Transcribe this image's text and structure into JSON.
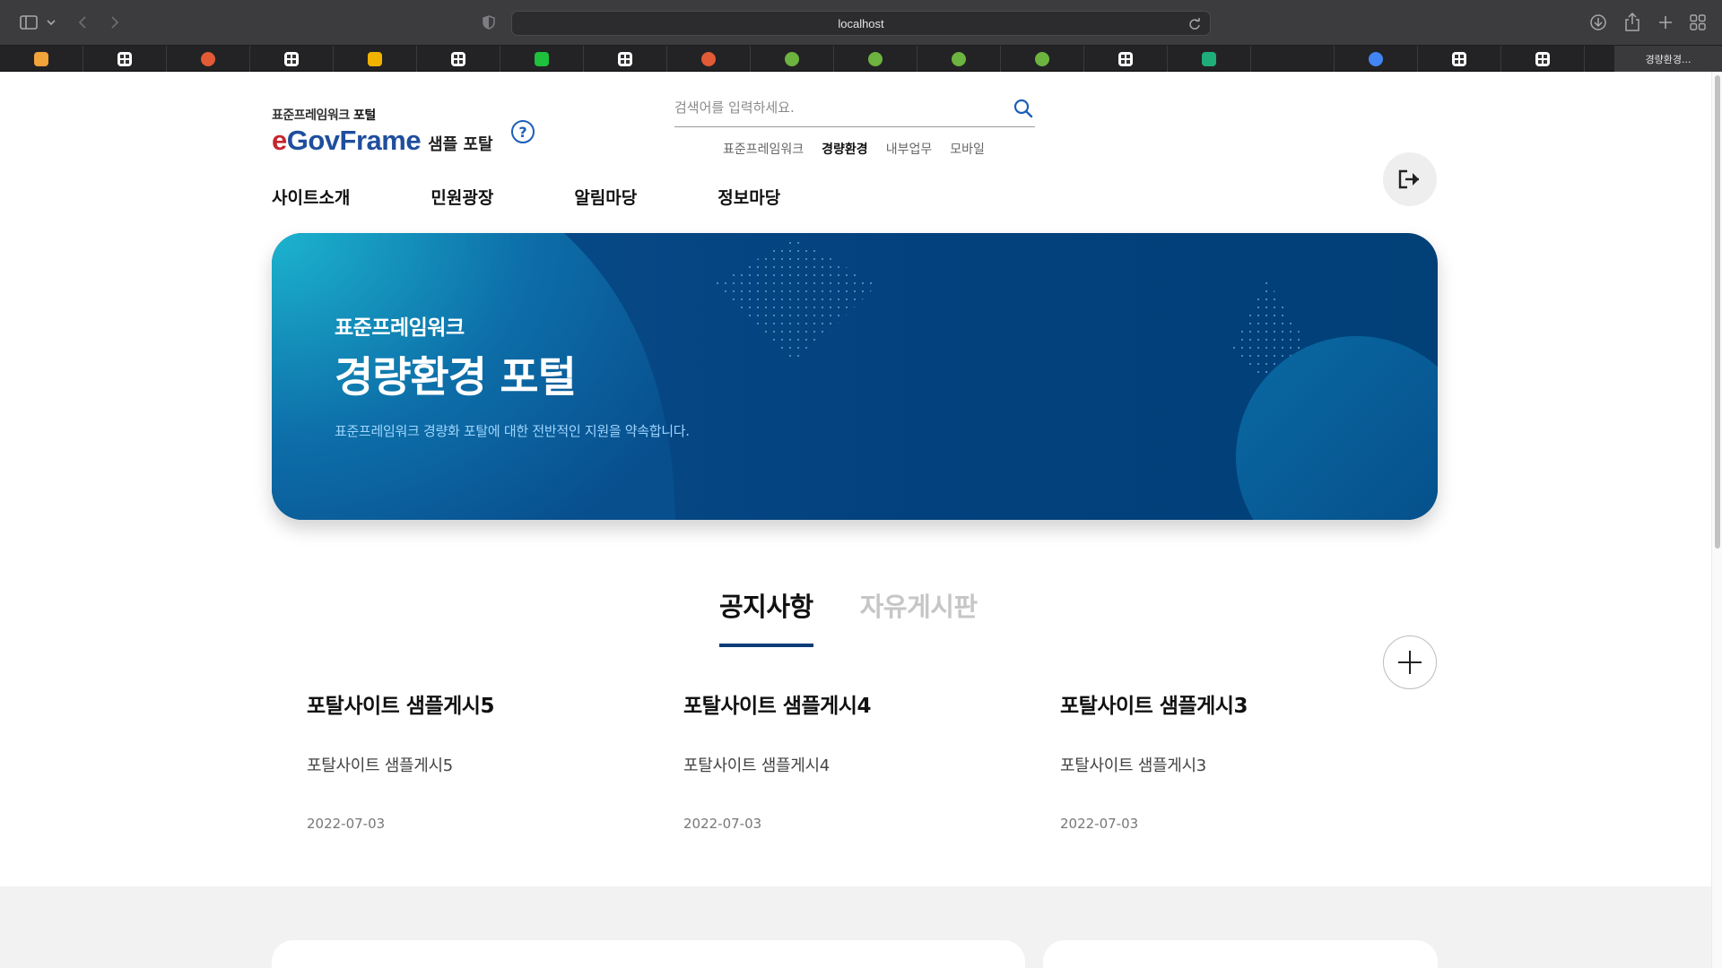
{
  "browser": {
    "url": "localhost",
    "active_tab_title": "경량환경...",
    "bookmarks": [
      {
        "icon": "orange-square-icon",
        "color": "#f2a33a"
      },
      {
        "icon": "grid-app-icon",
        "color": "#ffffff"
      },
      {
        "icon": "striped-flag-icon",
        "color": "#e25b36"
      },
      {
        "icon": "grid-app-icon",
        "color": "#ffffff"
      },
      {
        "icon": "d-logo-icon",
        "color": "#f0b400"
      },
      {
        "icon": "grid-app-icon",
        "color": "#ffffff"
      },
      {
        "icon": "green-chat-icon",
        "color": "#1ec03c"
      },
      {
        "icon": "grid-app-icon",
        "color": "#ffffff"
      },
      {
        "icon": "striped-flag-icon",
        "color": "#e25b36"
      },
      {
        "icon": "spring-leaf-icon",
        "color": "#6db33f"
      },
      {
        "icon": "spring-leaf-icon",
        "color": "#6db33f"
      },
      {
        "icon": "spring-leaf-icon",
        "color": "#6db33f"
      },
      {
        "icon": "spring-leaf-icon",
        "color": "#6db33f"
      },
      {
        "icon": "grid-app-icon",
        "color": "#ffffff"
      },
      {
        "icon": "v-logo-icon",
        "color": "#1fae7a"
      },
      {
        "icon": "empty",
        "color": ""
      },
      {
        "icon": "google-g-icon",
        "color": "#4285f4"
      },
      {
        "icon": "grid-app-icon",
        "color": "#ffffff"
      },
      {
        "icon": "grid-app-icon",
        "color": "#ffffff"
      }
    ]
  },
  "header": {
    "logo_sub_prefix": "표준프레임워크",
    "logo_sub_bold": "포털",
    "logo_e": "e",
    "logo_name": "GovFrame",
    "logo_tail": "샘플 포탈",
    "help_label": "?",
    "search_placeholder": "검색어를 입력하세요.",
    "subnav": [
      {
        "label": "표준프레임워크",
        "active": false
      },
      {
        "label": "경량환경",
        "active": true
      },
      {
        "label": "내부업무",
        "active": false
      },
      {
        "label": "모바일",
        "active": false
      }
    ],
    "gnb": [
      "사이트소개",
      "민원광장",
      "알림마당",
      "정보마당"
    ]
  },
  "hero": {
    "title_small": "표준프레임워크",
    "title_large": "경량환경 포털",
    "description": "표준프레임워크 경량화 포탈에 대한 전반적인 지원을 약속합니다."
  },
  "board": {
    "tabs": [
      {
        "label": "공지사항",
        "active": true
      },
      {
        "label": "자유게시판",
        "active": false
      }
    ],
    "posts": [
      {
        "title": "포탈사이트 샘플게시5",
        "body": "포탈사이트 샘플게시5",
        "date": "2022-07-03"
      },
      {
        "title": "포탈사이트 샘플게시4",
        "body": "포탈사이트 샘플게시4",
        "date": "2022-07-03"
      },
      {
        "title": "포탈사이트 샘플게시3",
        "body": "포탈사이트 샘플게시3",
        "date": "2022-07-03"
      }
    ]
  },
  "colors": {
    "brand_blue": "#1b5fb8",
    "logo_red": "#c4262e",
    "hero_navy": "#03417e",
    "tab_underline": "#0a3c7a"
  }
}
